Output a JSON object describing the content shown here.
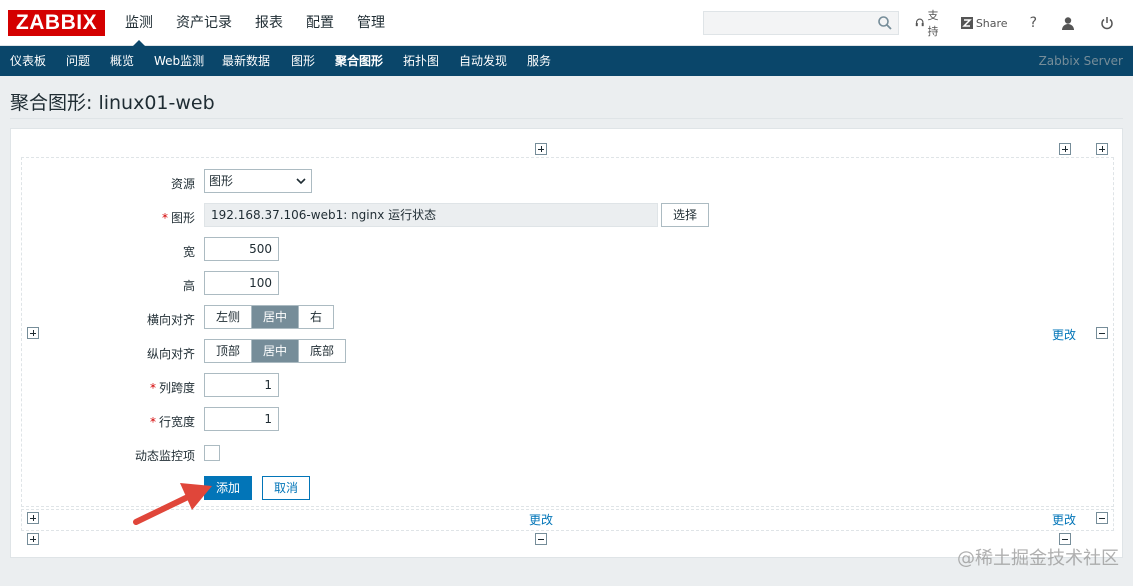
{
  "topbar": {
    "logo": "ZABBIX",
    "menu": [
      "监测",
      "资产记录",
      "报表",
      "配置",
      "管理"
    ],
    "search_placeholder": "",
    "support": "支持",
    "share": "Share",
    "help": "?"
  },
  "submenu": {
    "items": [
      "仪表板",
      "问题",
      "概览",
      "Web监测",
      "最新数据",
      "图形",
      "聚合图形",
      "拓扑图",
      "自动发现",
      "服务"
    ],
    "active": "聚合图形",
    "server": "Zabbix Server"
  },
  "page": {
    "title": "聚合图形: linux01-web"
  },
  "form": {
    "resource_label": "资源",
    "resource_value": "图形",
    "graph_label": "图形",
    "graph_value": "192.168.37.106-web1: nginx 运行状态",
    "select_button": "选择",
    "width_label": "宽",
    "width_value": "500",
    "height_label": "高",
    "height_value": "100",
    "halign_label": "横向对齐",
    "halign_options": [
      "左侧",
      "居中",
      "右"
    ],
    "halign_selected": "居中",
    "valign_label": "纵向对齐",
    "valign_options": [
      "顶部",
      "居中",
      "底部"
    ],
    "valign_selected": "居中",
    "colspan_label": "列跨度",
    "colspan_value": "1",
    "rowspan_label": "行宽度",
    "rowspan_value": "1",
    "dynamic_label": "动态监控项",
    "dynamic_checked": false,
    "add_button": "添加",
    "cancel_button": "取消"
  },
  "grid": {
    "change_link": "更改"
  },
  "watermark": "@稀土掘金技术社区",
  "colors": {
    "brand": "#d40000",
    "nav": "#0a466a",
    "primary": "#0275b8",
    "arrow": "#e0463a"
  }
}
